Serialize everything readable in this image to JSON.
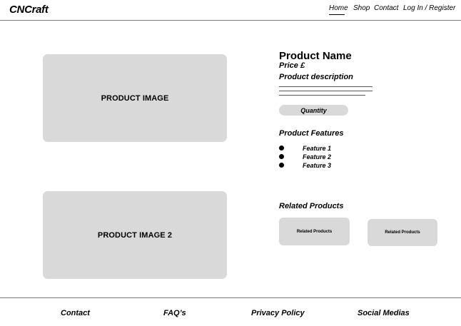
{
  "header": {
    "logo": "CNCraft",
    "nav": {
      "home": "Home",
      "shop": "Shop",
      "contact": "Contact",
      "login": "Log In / Register"
    },
    "active_nav": "Home"
  },
  "product": {
    "image_1_label": "PRODUCT IMAGE",
    "image_2_label": "PRODUCT IMAGE 2",
    "name": "Product Name",
    "price": "Price £",
    "description_title": "Product description",
    "quantity_label": "Quantity",
    "features_title": "Product Features",
    "features": [
      "Feature 1",
      "Feature 2",
      "Feature 3"
    ]
  },
  "related": {
    "title": "Related Products",
    "cards": [
      "Related Products",
      "Related Products"
    ]
  },
  "footer": {
    "links": [
      "Contact",
      "FAQ’s",
      "Privacy Policy",
      "Social Medias"
    ]
  },
  "colors": {
    "placeholder_gray": "#d9d9d9",
    "rule_gray": "#7a7a7a",
    "text": "#000000",
    "background": "#ffffff"
  }
}
